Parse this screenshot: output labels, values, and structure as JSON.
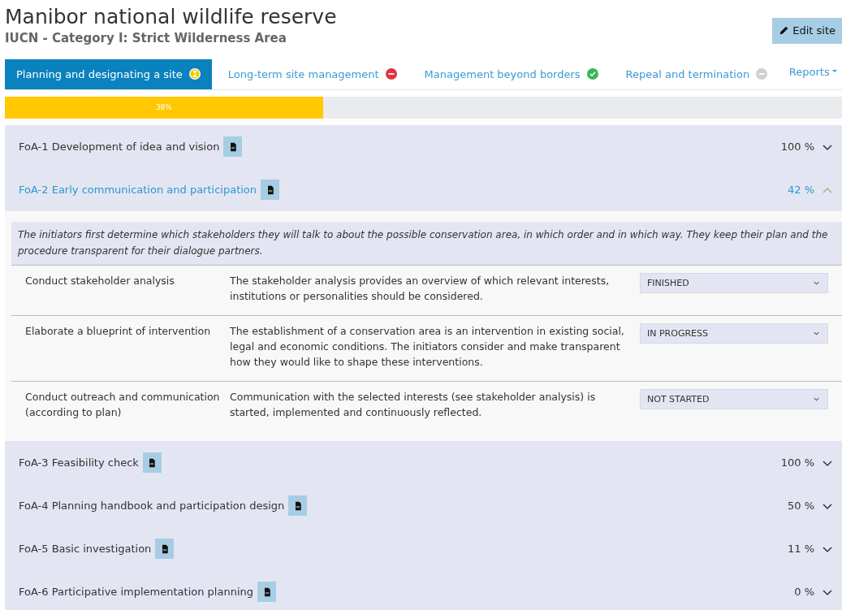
{
  "header": {
    "title": "Manibor national wildlife reserve",
    "subtitle": "IUCN - Category I: Strict Wilderness Area",
    "edit_button": "Edit site"
  },
  "tabs": [
    {
      "label": "Planning and designating a site",
      "kind": "pending",
      "selected": true
    },
    {
      "label": "Long-term site management",
      "kind": "blocked",
      "selected": false
    },
    {
      "label": "Management beyond borders",
      "kind": "done",
      "selected": false
    },
    {
      "label": "Repeal and termination",
      "kind": "inactive",
      "selected": false
    }
  ],
  "reports_menu": "Reports",
  "progress": {
    "level": 0.38,
    "label": "38%"
  },
  "sections": [
    {
      "title": "FoA-1 Development of idea and vision",
      "percent": "100 %",
      "expanded": false
    },
    {
      "title": "FoA-2 Early communication and participation",
      "percent": "42 %",
      "expanded": true,
      "description": "The initiators first determine which stakeholders they will talk to about the possible conservation area, in which order and in which way. They keep their plan and the procedure transparent for their dialogue partners.",
      "tasks": [
        {
          "name": "Conduct stakeholder analysis",
          "description": "The stakeholder analysis provides an overview of which relevant interests, institutions or personalities should be considered.",
          "status": "FINISHED"
        },
        {
          "name": "Elaborate a blueprint of intervention",
          "description": "The establishment of a conservation area is an intervention in existing social, legal and economic conditions. The initiators consider and make transparent how they would like to shape these interventions.",
          "status": "IN PROGRESS"
        },
        {
          "name": "Conduct outreach and communication (according to plan)",
          "description": "Communication with the selected interests (see stakeholder analysis) is started, implemented and continuously reflected.",
          "status": "NOT STARTED"
        }
      ]
    },
    {
      "title": "FoA-3 Feasibility check",
      "percent": "100 %",
      "expanded": false
    },
    {
      "title": "FoA-4 Planning handbook and participation design",
      "percent": "50 %",
      "expanded": false
    },
    {
      "title": "FoA-5 Basic investigation",
      "percent": "11 %",
      "expanded": false
    },
    {
      "title": "FoA-6 Participative implementation planning",
      "percent": "0 %",
      "expanded": false
    }
  ]
}
